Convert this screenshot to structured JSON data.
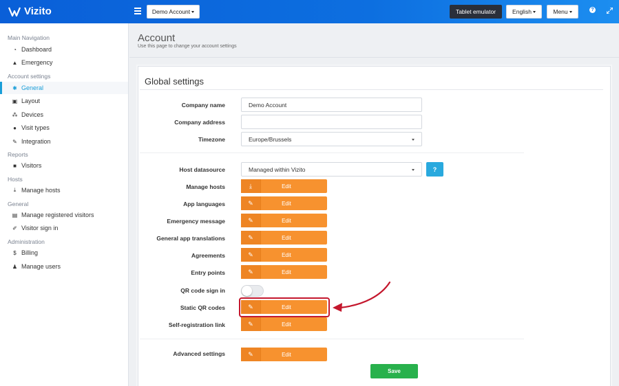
{
  "brand": {
    "name": "Vizito"
  },
  "topbar": {
    "account_selector": "Demo Account",
    "tablet_emulator": "Tablet emulator",
    "language": "English",
    "menu": "Menu",
    "help_icon": "?",
    "expand_icon": "expand-icon"
  },
  "sidebar": {
    "sections": [
      {
        "title": "Main Navigation"
      },
      {
        "title": "Account settings"
      },
      {
        "title": "Reports"
      },
      {
        "title": "Hosts"
      },
      {
        "title": "General"
      },
      {
        "title": "Administration"
      }
    ],
    "items": [
      {
        "label": "Dashboard",
        "icon": "dashboard-icon"
      },
      {
        "label": "Emergency",
        "icon": "warning-icon"
      },
      {
        "label": "General",
        "icon": "gear-icon",
        "active": true
      },
      {
        "label": "Layout",
        "icon": "image-icon"
      },
      {
        "label": "Devices",
        "icon": "sitemap-icon"
      },
      {
        "label": "Visit types",
        "icon": "users-icon"
      },
      {
        "label": "Integration",
        "icon": "plug-icon"
      },
      {
        "label": "Visitors",
        "icon": "book-icon"
      },
      {
        "label": "Manage hosts",
        "icon": "download-icon"
      },
      {
        "label": "Manage registered visitors",
        "icon": "address-card-icon"
      },
      {
        "label": "Visitor sign in",
        "icon": "pencil-icon"
      },
      {
        "label": "Billing",
        "icon": "dollar-icon"
      },
      {
        "label": "Manage users",
        "icon": "user-plus-icon"
      }
    ]
  },
  "page": {
    "title": "Account",
    "subtitle": "Use this page to change your account settings"
  },
  "card": {
    "title": "Global settings",
    "fields": {
      "company_name": {
        "label": "Company name",
        "value": "Demo Account"
      },
      "company_address": {
        "label": "Company address",
        "value": ""
      },
      "timezone": {
        "label": "Timezone",
        "value": "Europe/Brussels"
      },
      "host_datasource": {
        "label": "Host datasource",
        "value": "Managed within Vizito",
        "help": "?"
      }
    },
    "edit_rows": [
      {
        "label": "Manage hosts",
        "button": "Edit",
        "icon": "download-icon"
      },
      {
        "label": "App languages",
        "button": "Edit",
        "icon": "edit-icon"
      },
      {
        "label": "Emergency message",
        "button": "Edit",
        "icon": "edit-icon"
      },
      {
        "label": "General app translations",
        "button": "Edit",
        "icon": "edit-icon"
      },
      {
        "label": "Agreements",
        "button": "Edit",
        "icon": "edit-icon"
      },
      {
        "label": "Entry points",
        "button": "Edit",
        "icon": "edit-icon"
      }
    ],
    "qr_sign_in": {
      "label": "QR code sign in",
      "enabled": false
    },
    "edit_rows_2": [
      {
        "label": "Static QR codes",
        "button": "Edit",
        "icon": "edit-icon"
      },
      {
        "label": "Self-registration link",
        "button": "Edit",
        "icon": "edit-icon"
      }
    ],
    "advanced": {
      "label": "Advanced settings",
      "button": "Edit",
      "icon": "edit-icon"
    },
    "save": "Save"
  },
  "colors": {
    "topbar": "#0d6fe0",
    "accent": "#1a9ed8",
    "edit_button": "#f7922f",
    "save_button": "#28b14c",
    "highlight": "#c4172d"
  }
}
